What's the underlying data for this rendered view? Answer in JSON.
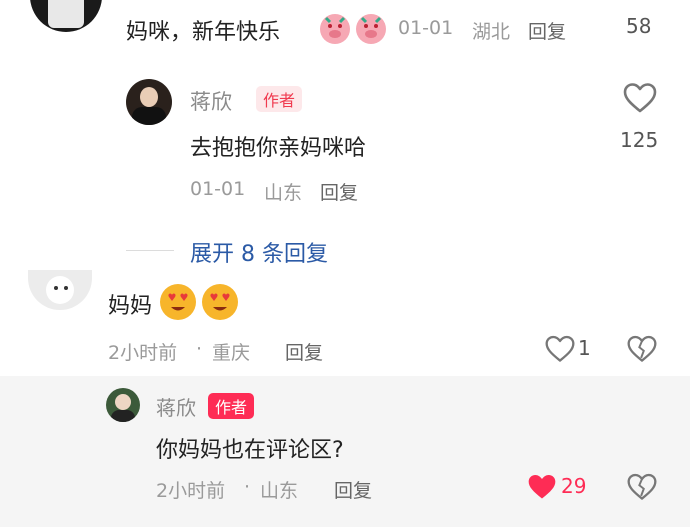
{
  "comment1": {
    "text": "妈咪，新年快乐",
    "date": "01-01",
    "location": "湖北",
    "reply": "回复",
    "likes": "58"
  },
  "reply1": {
    "name": "蒋欣",
    "badge": "作者",
    "text": "去抱抱你亲妈咪哈",
    "date": "01-01",
    "location": "山东",
    "reply": "回复",
    "likes": "125"
  },
  "expand": {
    "label": "展开 8 条回复"
  },
  "comment2": {
    "text": "妈妈",
    "time": "2小时前",
    "sep": "·",
    "location": "重庆",
    "reply": "回复",
    "likes": "1"
  },
  "reply2": {
    "name": "蒋欣",
    "badge": "作者",
    "text": "你妈妈也在评论区?",
    "time": "2小时前",
    "sep": "·",
    "location": "山东",
    "reply": "回复",
    "likes": "29"
  },
  "colors": {
    "accent": "#fe2c55",
    "link": "#2b5aa6",
    "liked_heart": "#fe2c55"
  },
  "icons": {
    "like": "heart-outline-icon",
    "liked": "heart-filled-icon",
    "dislike": "broken-heart-icon"
  }
}
